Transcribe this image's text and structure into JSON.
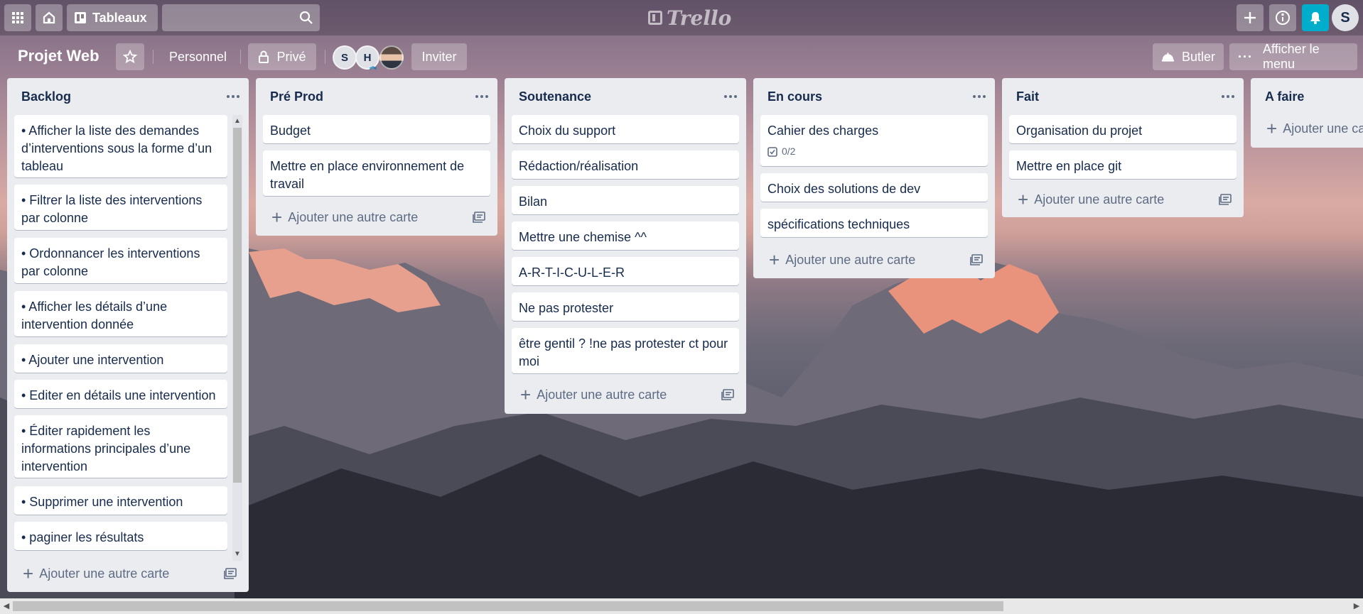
{
  "topbar": {
    "boards_label": "Tableaux",
    "search_placeholder": "",
    "logo_text": "Trello",
    "user_initial": "S"
  },
  "board": {
    "title": "Projet Web",
    "team_label": "Personnel",
    "visibility_label": "Privé",
    "members": [
      "S",
      "H"
    ],
    "invite_label": "Inviter",
    "butler_label": "Butler",
    "menu_label": "Afficher le menu"
  },
  "lists": [
    {
      "title": "Backlog",
      "cards": [
        {
          "text": "• Afficher la liste des demandes d’interventions sous la forme d’un tableau"
        },
        {
          "text": "• Filtrer la liste des interventions par colonne"
        },
        {
          "text": "• Ordonnancer les interventions par colonne"
        },
        {
          "text": "• Afficher les détails d’une intervention donnée"
        },
        {
          "text": "• Ajouter une intervention"
        },
        {
          "text": "• Editer en détails une intervention"
        },
        {
          "text": "• Éditer rapidement les informations principales d’une intervention"
        },
        {
          "text": "• Supprimer une intervention"
        },
        {
          "text": "• paginer les résultats"
        }
      ],
      "add_label": "Ajouter une autre carte"
    },
    {
      "title": "Pré Prod",
      "cards": [
        {
          "text": "Budget"
        },
        {
          "text": "Mettre en place environnement de travail"
        }
      ],
      "add_label": "Ajouter une autre carte"
    },
    {
      "title": "Soutenance",
      "cards": [
        {
          "text": "Choix du support"
        },
        {
          "text": "Rédaction/réalisation"
        },
        {
          "text": "Bilan"
        },
        {
          "text": "Mettre une chemise ^^"
        },
        {
          "text": "A-R-T-I-C-U-L-E-R"
        },
        {
          "text": "Ne pas protester"
        },
        {
          "text": "être gentil ? !ne pas protester ct pour moi"
        }
      ],
      "add_label": "Ajouter une autre carte"
    },
    {
      "title": "En cours",
      "cards": [
        {
          "text": "Cahier des charges",
          "checklist": "0/2"
        },
        {
          "text": "Choix des solutions de dev"
        },
        {
          "text": "spécifications techniques"
        }
      ],
      "add_label": "Ajouter une autre carte"
    },
    {
      "title": "Fait",
      "cards": [
        {
          "text": "Organisation du projet"
        },
        {
          "text": "Mettre en place git"
        }
      ],
      "add_label": "Ajouter une autre carte"
    },
    {
      "title": "A faire",
      "cards": [],
      "add_label": "Ajouter une ca"
    }
  ]
}
